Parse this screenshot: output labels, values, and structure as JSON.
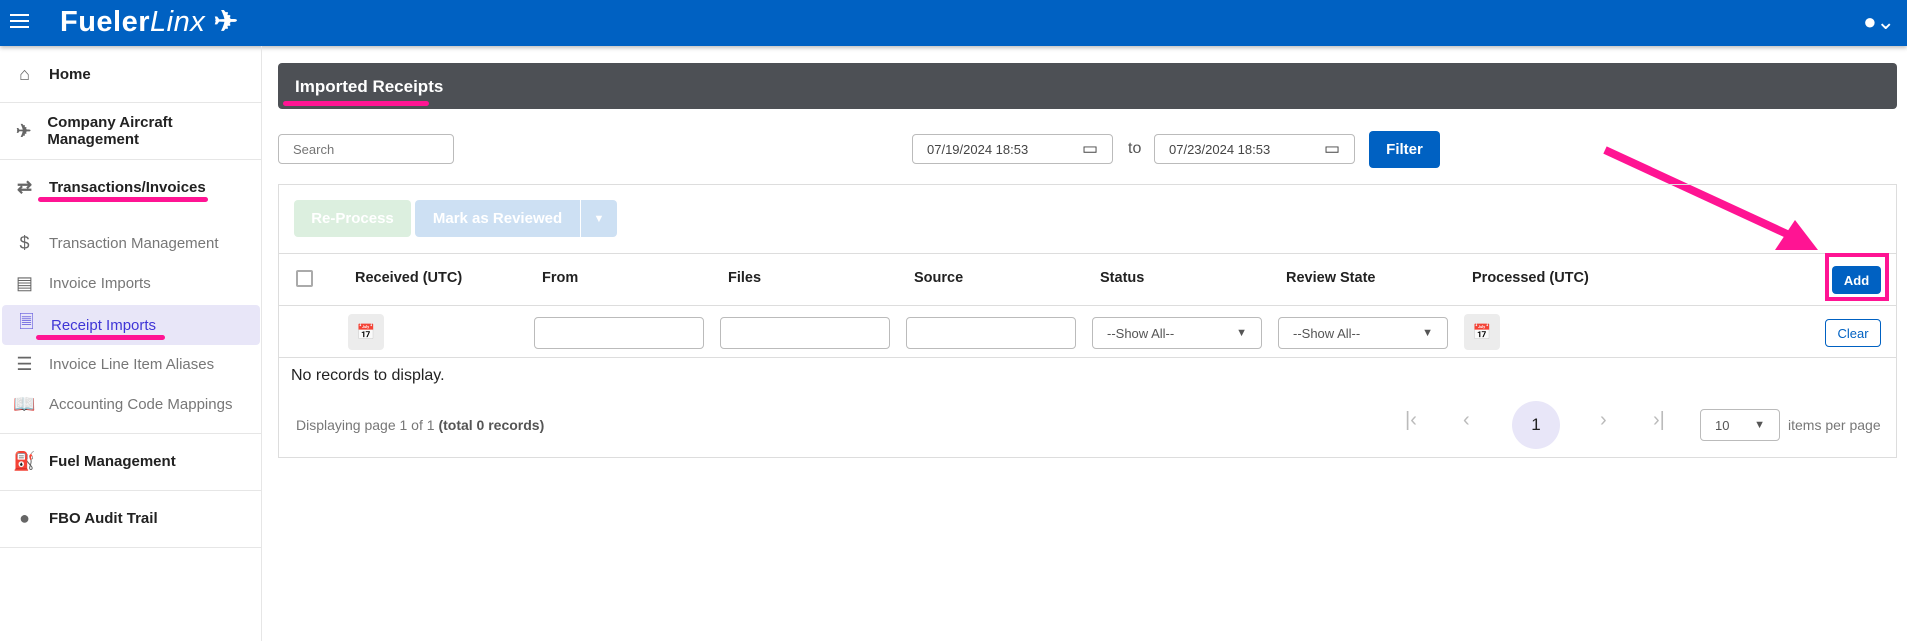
{
  "app": {
    "logo": "FuelerLinx"
  },
  "sidebar": {
    "items": [
      {
        "label": "Home",
        "icon": "home-icon"
      },
      {
        "label": "Company Aircraft Management",
        "icon": "airplane-icon"
      },
      {
        "label": "Transactions/Invoices",
        "icon": "swap-icon"
      },
      {
        "label": "Transaction Management",
        "icon": "dollar-icon"
      },
      {
        "label": "Invoice Imports",
        "icon": "invoice-icon"
      },
      {
        "label": "Receipt Imports",
        "icon": "receipt-icon"
      },
      {
        "label": "Invoice Line Item Aliases",
        "icon": "list-icon"
      },
      {
        "label": "Accounting Code Mappings",
        "icon": "book-icon"
      },
      {
        "label": "Fuel Management",
        "icon": "fuel-pump-icon"
      },
      {
        "label": "FBO Audit Trail",
        "icon": "account-icon"
      }
    ]
  },
  "page": {
    "title": "Imported Receipts"
  },
  "filters": {
    "search_placeholder": "Search",
    "date_from": "07/19/2024 18:53",
    "to": "to",
    "date_to": "07/23/2024 18:53",
    "filter": "Filter"
  },
  "toolbar": {
    "reprocess": "Re-Process",
    "mark_reviewed": "Mark as Reviewed"
  },
  "table": {
    "columns": [
      "Received (UTC)",
      "From",
      "Files",
      "Source",
      "Status",
      "Review State",
      "Processed (UTC)"
    ],
    "add": "Add",
    "clear": "Clear",
    "show_all": "--Show All--",
    "empty": "No records to display."
  },
  "pager": {
    "info": "Displaying page 1 of 1",
    "total": "(total 0 records)",
    "current": "1",
    "page_size": "10",
    "per_page": "items per page"
  },
  "colors": {
    "brand": "#0061c2",
    "annotation": "#ff1493"
  }
}
